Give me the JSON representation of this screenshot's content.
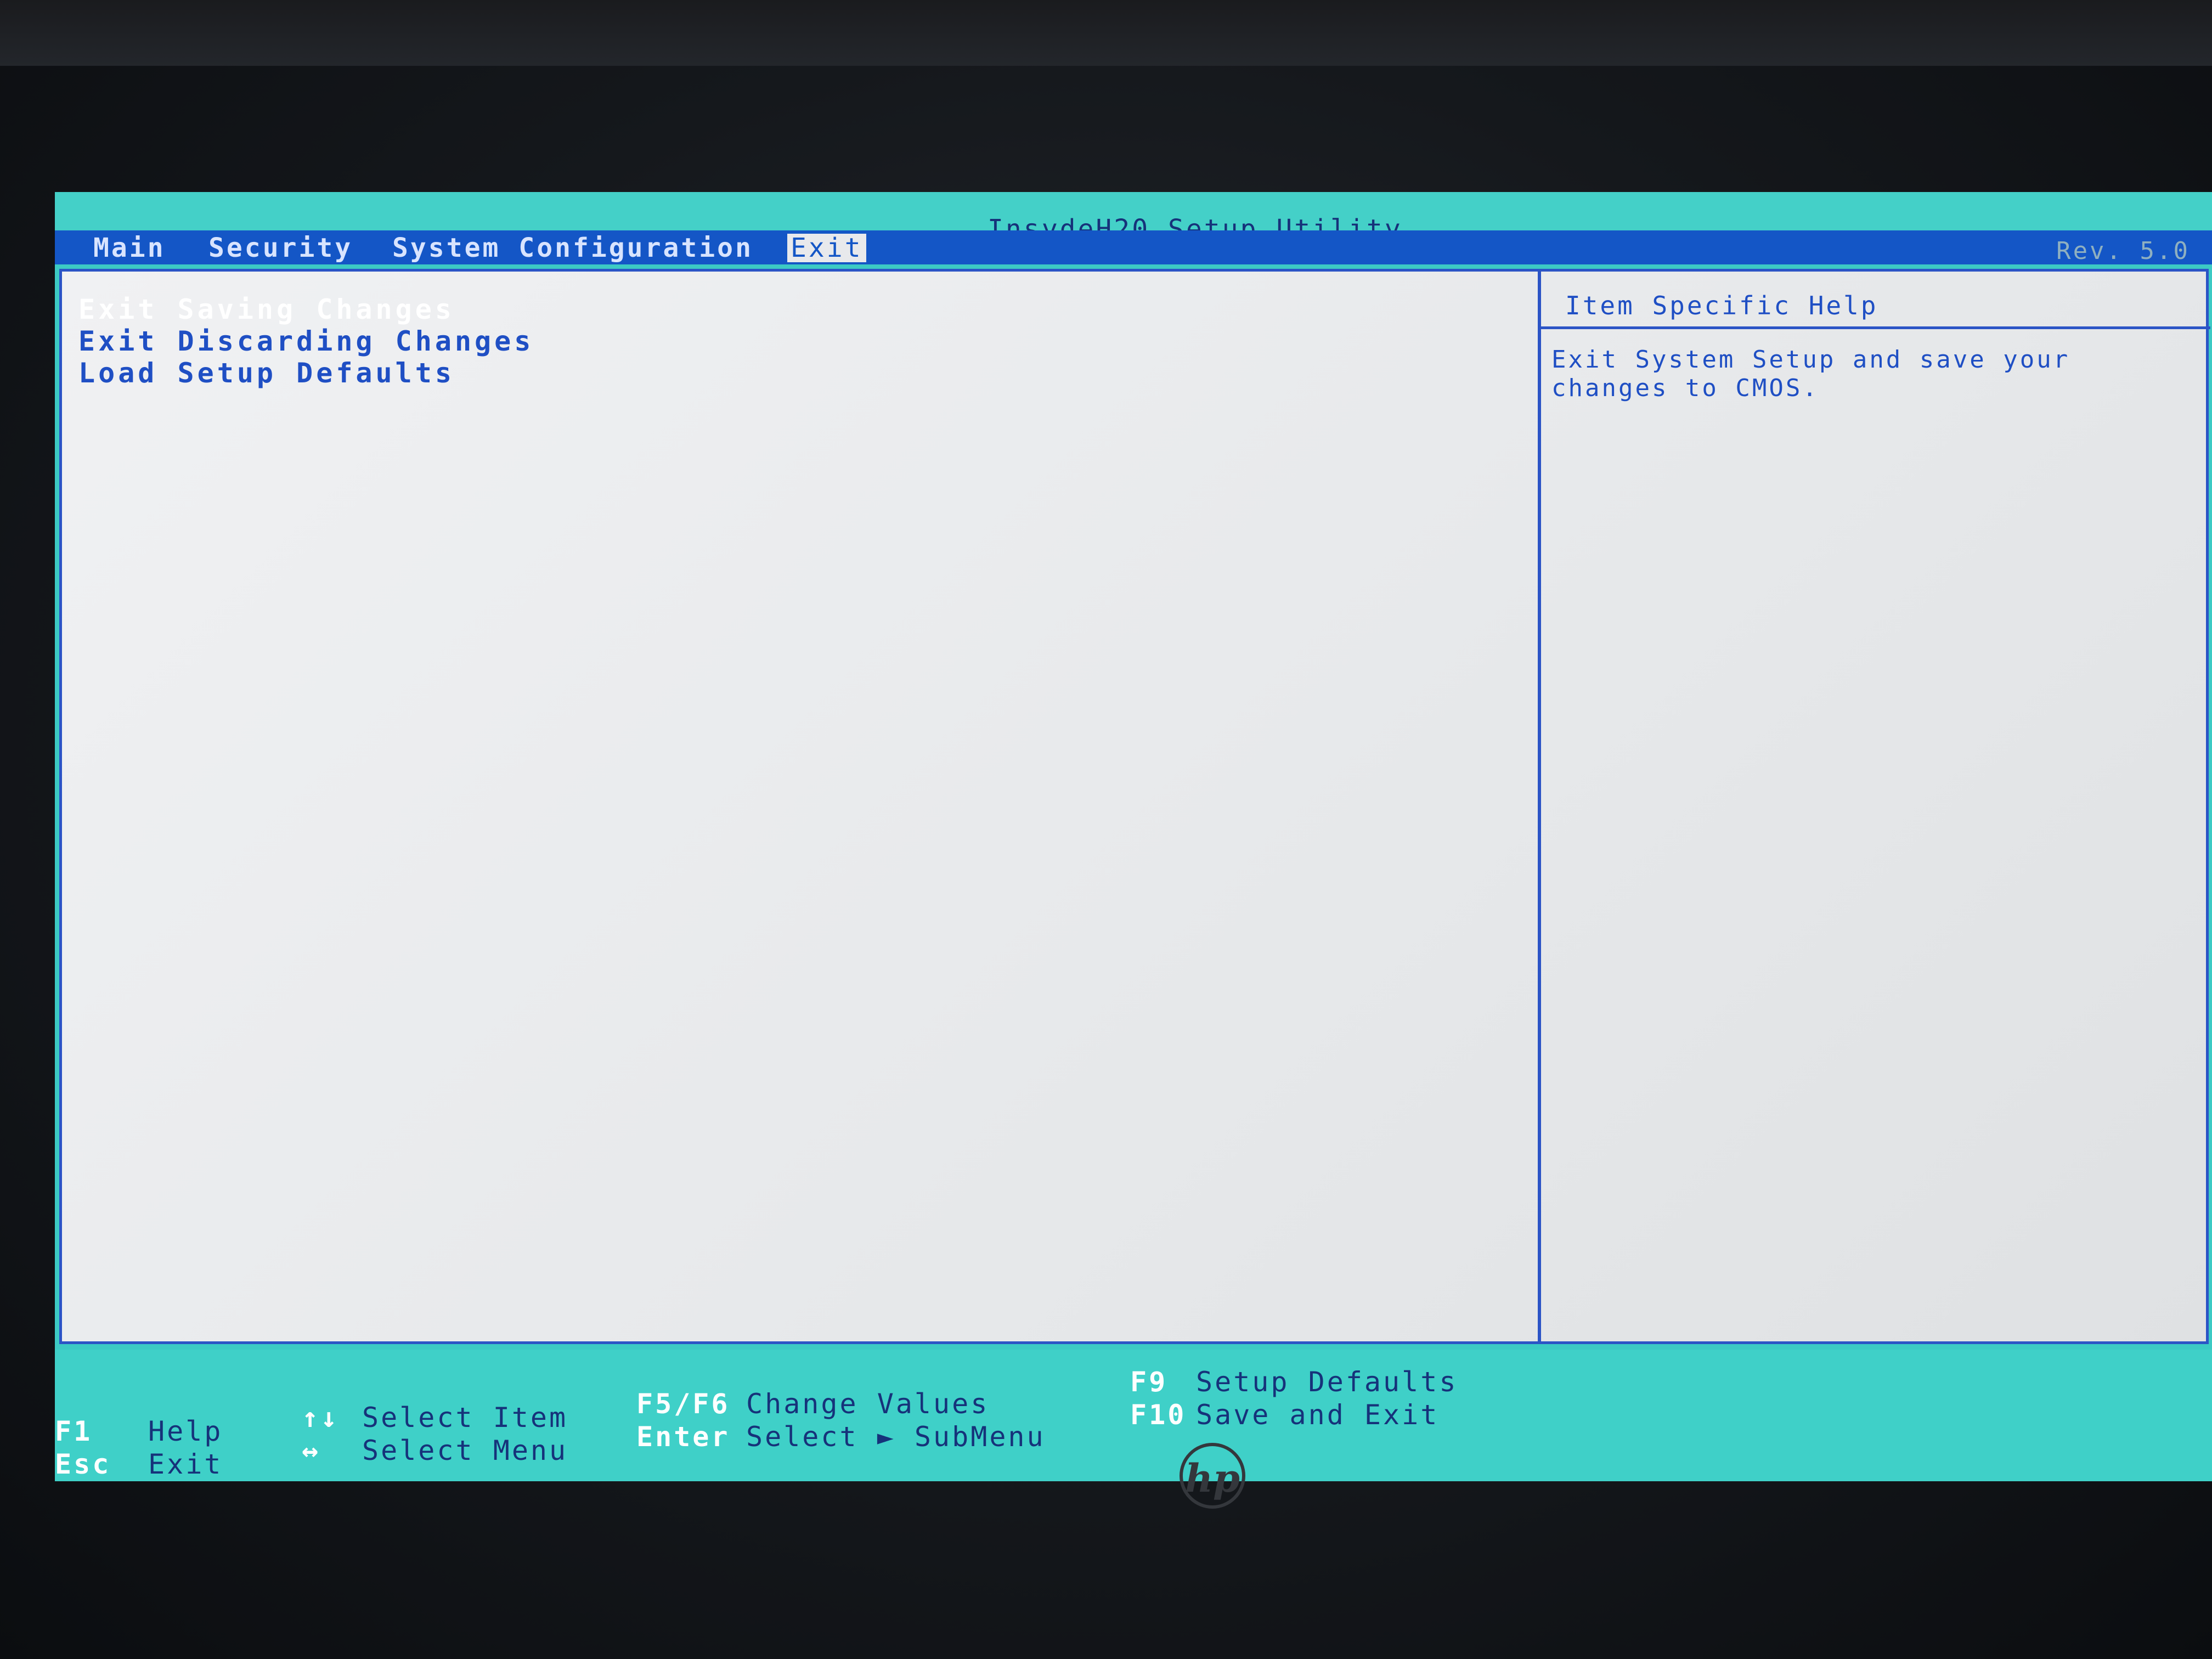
{
  "header": {
    "title": "InsydeH20 Setup Utility",
    "revision": "Rev. 5.0"
  },
  "menu": {
    "items": [
      {
        "label": "Main"
      },
      {
        "label": "Security"
      },
      {
        "label": "System Configuration"
      },
      {
        "label": "Exit",
        "active": true
      }
    ]
  },
  "exit_menu": {
    "options": [
      {
        "label": "Exit Saving Changes",
        "selected": true
      },
      {
        "label": "Exit Discarding Changes"
      },
      {
        "label": "Load Setup Defaults"
      }
    ]
  },
  "help_panel": {
    "title": "Item Specific Help",
    "text": "Exit System Setup and save your changes to CMOS."
  },
  "footer": {
    "f1_key": "F1",
    "f1_desc": "Help",
    "esc_key": "Esc",
    "esc_desc": "Exit",
    "updown_key": "↑↓",
    "updown_desc": "Select Item",
    "leftright_key": "↔",
    "leftright_desc": "Select Menu",
    "f5f6_key": "F5/F6",
    "f5f6_desc": "Change Values",
    "enter_key": "Enter",
    "enter_desc": "Select ► SubMenu",
    "f9_key": "F9",
    "f9_desc": "Setup Defaults",
    "f10_key": "F10",
    "f10_desc": "Save and Exit"
  },
  "bezel": {
    "logo": "hp"
  },
  "colors": {
    "teal": "#3ccac4",
    "blue": "#1456c6",
    "panel": "#e9ebed"
  }
}
